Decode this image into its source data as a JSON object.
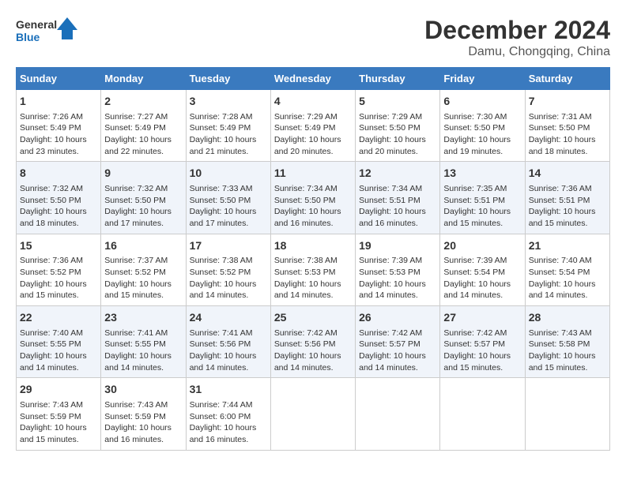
{
  "logo": {
    "line1": "General",
    "line2": "Blue"
  },
  "title": "December 2024",
  "subtitle": "Damu, Chongqing, China",
  "headers": [
    "Sunday",
    "Monday",
    "Tuesday",
    "Wednesday",
    "Thursday",
    "Friday",
    "Saturday"
  ],
  "weeks": [
    [
      {
        "day": "1",
        "info": "Sunrise: 7:26 AM\nSunset: 5:49 PM\nDaylight: 10 hours\nand 23 minutes."
      },
      {
        "day": "2",
        "info": "Sunrise: 7:27 AM\nSunset: 5:49 PM\nDaylight: 10 hours\nand 22 minutes."
      },
      {
        "day": "3",
        "info": "Sunrise: 7:28 AM\nSunset: 5:49 PM\nDaylight: 10 hours\nand 21 minutes."
      },
      {
        "day": "4",
        "info": "Sunrise: 7:29 AM\nSunset: 5:49 PM\nDaylight: 10 hours\nand 20 minutes."
      },
      {
        "day": "5",
        "info": "Sunrise: 7:29 AM\nSunset: 5:50 PM\nDaylight: 10 hours\nand 20 minutes."
      },
      {
        "day": "6",
        "info": "Sunrise: 7:30 AM\nSunset: 5:50 PM\nDaylight: 10 hours\nand 19 minutes."
      },
      {
        "day": "7",
        "info": "Sunrise: 7:31 AM\nSunset: 5:50 PM\nDaylight: 10 hours\nand 18 minutes."
      }
    ],
    [
      {
        "day": "8",
        "info": "Sunrise: 7:32 AM\nSunset: 5:50 PM\nDaylight: 10 hours\nand 18 minutes."
      },
      {
        "day": "9",
        "info": "Sunrise: 7:32 AM\nSunset: 5:50 PM\nDaylight: 10 hours\nand 17 minutes."
      },
      {
        "day": "10",
        "info": "Sunrise: 7:33 AM\nSunset: 5:50 PM\nDaylight: 10 hours\nand 17 minutes."
      },
      {
        "day": "11",
        "info": "Sunrise: 7:34 AM\nSunset: 5:50 PM\nDaylight: 10 hours\nand 16 minutes."
      },
      {
        "day": "12",
        "info": "Sunrise: 7:34 AM\nSunset: 5:51 PM\nDaylight: 10 hours\nand 16 minutes."
      },
      {
        "day": "13",
        "info": "Sunrise: 7:35 AM\nSunset: 5:51 PM\nDaylight: 10 hours\nand 15 minutes."
      },
      {
        "day": "14",
        "info": "Sunrise: 7:36 AM\nSunset: 5:51 PM\nDaylight: 10 hours\nand 15 minutes."
      }
    ],
    [
      {
        "day": "15",
        "info": "Sunrise: 7:36 AM\nSunset: 5:52 PM\nDaylight: 10 hours\nand 15 minutes."
      },
      {
        "day": "16",
        "info": "Sunrise: 7:37 AM\nSunset: 5:52 PM\nDaylight: 10 hours\nand 15 minutes."
      },
      {
        "day": "17",
        "info": "Sunrise: 7:38 AM\nSunset: 5:52 PM\nDaylight: 10 hours\nand 14 minutes."
      },
      {
        "day": "18",
        "info": "Sunrise: 7:38 AM\nSunset: 5:53 PM\nDaylight: 10 hours\nand 14 minutes."
      },
      {
        "day": "19",
        "info": "Sunrise: 7:39 AM\nSunset: 5:53 PM\nDaylight: 10 hours\nand 14 minutes."
      },
      {
        "day": "20",
        "info": "Sunrise: 7:39 AM\nSunset: 5:54 PM\nDaylight: 10 hours\nand 14 minutes."
      },
      {
        "day": "21",
        "info": "Sunrise: 7:40 AM\nSunset: 5:54 PM\nDaylight: 10 hours\nand 14 minutes."
      }
    ],
    [
      {
        "day": "22",
        "info": "Sunrise: 7:40 AM\nSunset: 5:55 PM\nDaylight: 10 hours\nand 14 minutes."
      },
      {
        "day": "23",
        "info": "Sunrise: 7:41 AM\nSunset: 5:55 PM\nDaylight: 10 hours\nand 14 minutes."
      },
      {
        "day": "24",
        "info": "Sunrise: 7:41 AM\nSunset: 5:56 PM\nDaylight: 10 hours\nand 14 minutes."
      },
      {
        "day": "25",
        "info": "Sunrise: 7:42 AM\nSunset: 5:56 PM\nDaylight: 10 hours\nand 14 minutes."
      },
      {
        "day": "26",
        "info": "Sunrise: 7:42 AM\nSunset: 5:57 PM\nDaylight: 10 hours\nand 14 minutes."
      },
      {
        "day": "27",
        "info": "Sunrise: 7:42 AM\nSunset: 5:57 PM\nDaylight: 10 hours\nand 15 minutes."
      },
      {
        "day": "28",
        "info": "Sunrise: 7:43 AM\nSunset: 5:58 PM\nDaylight: 10 hours\nand 15 minutes."
      }
    ],
    [
      {
        "day": "29",
        "info": "Sunrise: 7:43 AM\nSunset: 5:59 PM\nDaylight: 10 hours\nand 15 minutes."
      },
      {
        "day": "30",
        "info": "Sunrise: 7:43 AM\nSunset: 5:59 PM\nDaylight: 10 hours\nand 16 minutes."
      },
      {
        "day": "31",
        "info": "Sunrise: 7:44 AM\nSunset: 6:00 PM\nDaylight: 10 hours\nand 16 minutes."
      },
      {
        "day": "",
        "info": ""
      },
      {
        "day": "",
        "info": ""
      },
      {
        "day": "",
        "info": ""
      },
      {
        "day": "",
        "info": ""
      }
    ]
  ]
}
